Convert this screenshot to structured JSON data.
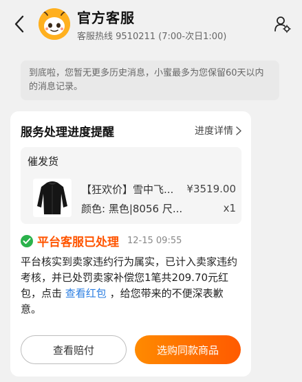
{
  "header": {
    "title": "官方客服",
    "subtitle": "客服热线 9510211 (7:00-次日1:00)"
  },
  "notice": {
    "text": "到底啦，您暂无更多历史消息，小蜜最多为您保留60天以内的消息记录。"
  },
  "card": {
    "title": "服务处理进度提醒",
    "progress_link": "进度详情",
    "order": {
      "type": "催发货",
      "product_name": "【狂欢价】雪中飞...",
      "attributes": "颜色: 黑色|8056 尺...",
      "price": "¥3519.00",
      "quantity": "x1"
    },
    "status": {
      "text": "平台客服已处理",
      "time": "12-15 09:55"
    },
    "message": {
      "part1": "平台核实到卖家违约行为属实，已计入卖家违约考核，并已处罚卖家补偿您1笔共209.70元红包，点击",
      "link": "查看红包",
      "part2": "，给您带来的不便深表歉意。"
    },
    "buttons": {
      "secondary": "查看赔付",
      "primary": "选购同款商品"
    }
  },
  "colors": {
    "accent": "#ff5500",
    "success": "#2ab24b",
    "link": "#2a7de1"
  },
  "icons": {
    "back": "chevron-left-icon",
    "profile": "user-settings-icon",
    "status": "check-circle-icon",
    "chevron": "chevron-right-icon"
  }
}
